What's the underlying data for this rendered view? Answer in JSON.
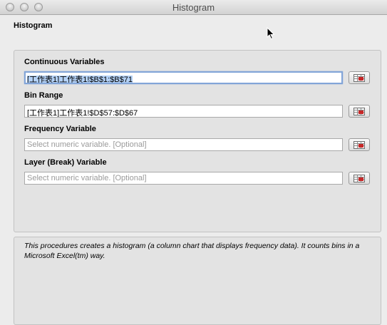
{
  "window": {
    "title": "Histogram"
  },
  "dialog": {
    "heading": "Histogram"
  },
  "fields": [
    {
      "label": "Continuous Variables",
      "value": "[工作表1]工作表1!$B$1:$B$71",
      "placeholder": ""
    },
    {
      "label": "Bin Range",
      "value": "[工作表1]工作表1!$D$57:$D$67",
      "placeholder": ""
    },
    {
      "label": "Frequency Variable",
      "value": "",
      "placeholder": "Select numeric variable. [Optional]"
    },
    {
      "label": "Layer (Break) Variable",
      "value": "",
      "placeholder": "Select numeric variable. [Optional]"
    }
  ],
  "description": "This procedures creates a histogram (a column chart that displays frequency data). It counts bins in a Microsoft Excel(tm) way.",
  "icons": {
    "range_picker": "range-select-icon",
    "cursor": "arrow-cursor"
  }
}
